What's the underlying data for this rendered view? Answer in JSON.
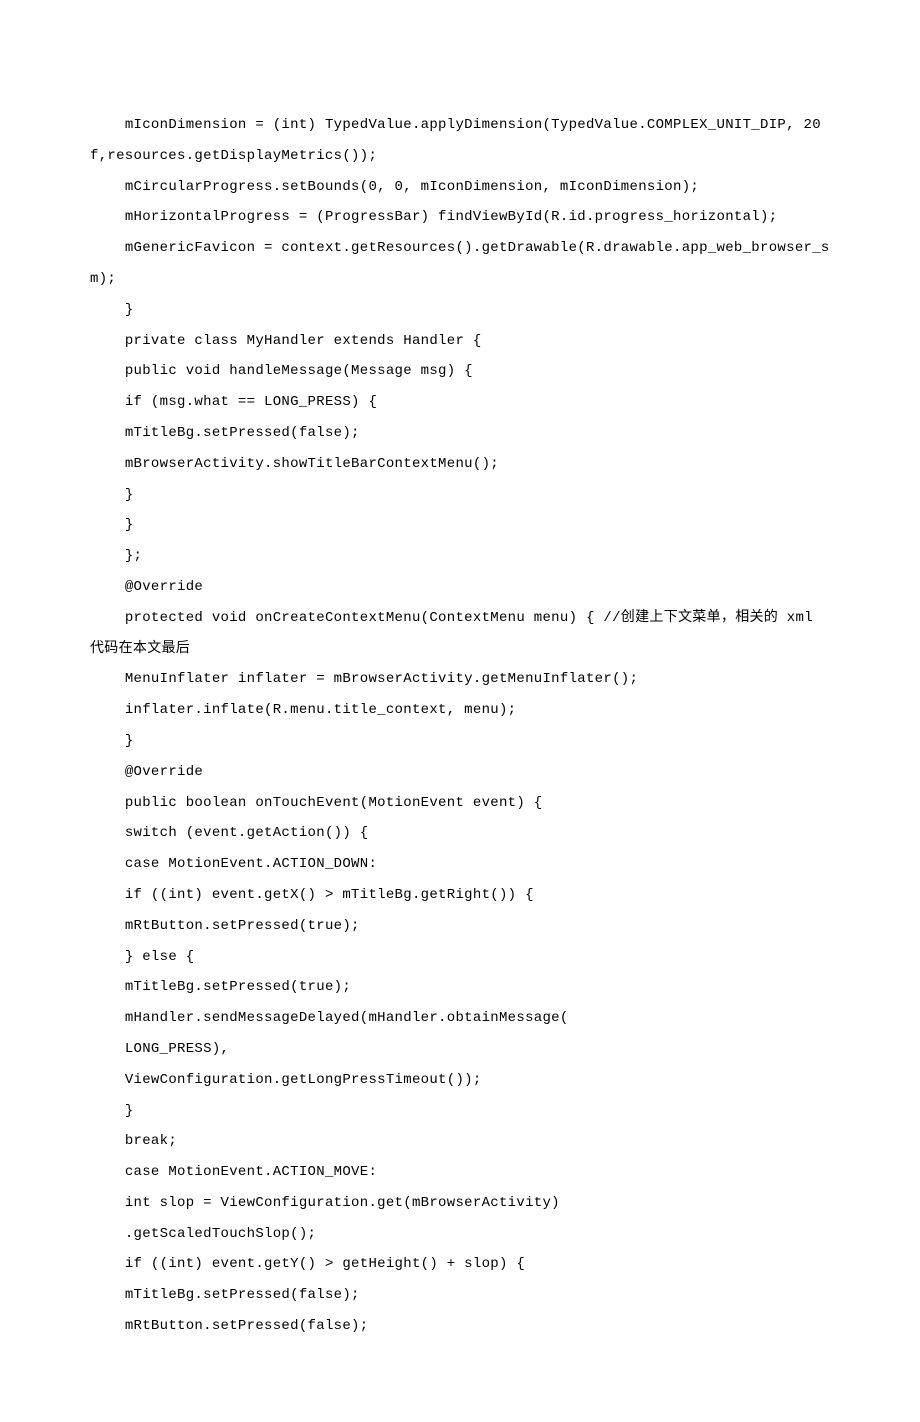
{
  "lines": [
    "    mIconDimension = (int) TypedValue.applyDimension(TypedValue.COMPLEX_UNIT_DIP, 20f,resources.getDisplayMetrics());",
    "    mCircularProgress.setBounds(0, 0, mIconDimension, mIconDimension);",
    "    mHorizontalProgress = (ProgressBar) findViewById(R.id.progress_horizontal);",
    "    mGenericFavicon = context.getResources().getDrawable(R.drawable.app_web_browser_sm);",
    "    }",
    "    private class MyHandler extends Handler {",
    "    public void handleMessage(Message msg) {",
    "    if (msg.what == LONG_PRESS) {",
    "    mTitleBg.setPressed(false);",
    "    mBrowserActivity.showTitleBarContextMenu();",
    "    }",
    "    }",
    "    };",
    "    @Override",
    "    protected void onCreateContextMenu(ContextMenu menu) { //创建上下文菜单，相关的 xml 代码在本文最后",
    "    MenuInflater inflater = mBrowserActivity.getMenuInflater();",
    "    inflater.inflate(R.menu.title_context, menu);",
    "    }",
    "    @Override",
    "    public boolean onTouchEvent(MotionEvent event) {",
    "    switch (event.getAction()) {",
    "    case MotionEvent.ACTION_DOWN:",
    "    if ((int) event.getX() > mTitleBg.getRight()) {",
    "    mRtButton.setPressed(true);",
    "    } else {",
    "    mTitleBg.setPressed(true);",
    "    mHandler.sendMessageDelayed(mHandler.obtainMessage(",
    "    LONG_PRESS),",
    "    ViewConfiguration.getLongPressTimeout());",
    "    }",
    "    break;",
    "    case MotionEvent.ACTION_MOVE:",
    "    int slop = ViewConfiguration.get(mBrowserActivity)",
    "    .getScaledTouchSlop();",
    "    if ((int) event.getY() > getHeight() + slop) {",
    "    mTitleBg.setPressed(false);",
    "    mRtButton.setPressed(false);"
  ]
}
